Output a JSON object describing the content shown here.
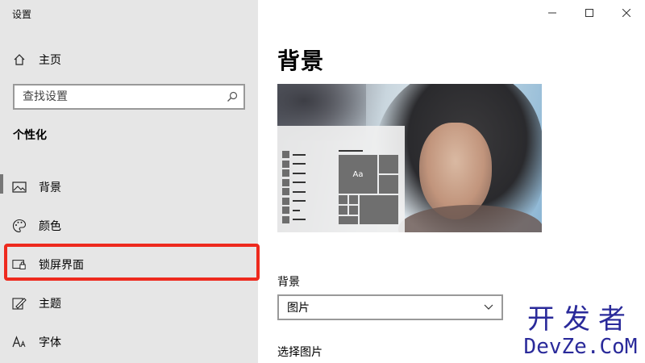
{
  "window": {
    "title": "设置"
  },
  "sidebar": {
    "home_label": "主页",
    "search_placeholder": "查找设置",
    "section_title": "个性化",
    "items": [
      {
        "label": "背景",
        "icon": "picture-icon"
      },
      {
        "label": "颜色",
        "icon": "palette-icon"
      },
      {
        "label": "锁屏界面",
        "icon": "lock-screen-icon"
      },
      {
        "label": "主题",
        "icon": "theme-icon"
      },
      {
        "label": "字体",
        "icon": "font-icon"
      }
    ],
    "active_item": "背景",
    "highlighted_item": "锁屏界面"
  },
  "main": {
    "title": "背景",
    "preview_tile_text": "Aa",
    "background_label": "背景",
    "background_value": "图片",
    "choose_picture_label": "选择图片"
  },
  "watermark": {
    "cn": "开发者",
    "en": "DevZe.CoM"
  },
  "colors": {
    "sidebar_bg": "#e6e6e6",
    "highlight": "#ee2a1e",
    "watermark": "#2a2a9a"
  }
}
